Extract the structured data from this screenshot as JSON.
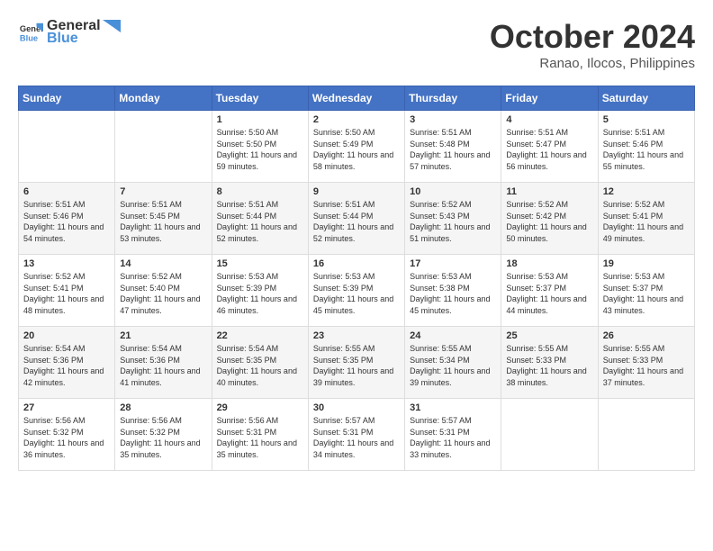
{
  "header": {
    "logo": {
      "general": "General",
      "blue": "Blue"
    },
    "title": "October 2024",
    "location": "Ranao, Ilocos, Philippines"
  },
  "weekdays": [
    "Sunday",
    "Monday",
    "Tuesday",
    "Wednesday",
    "Thursday",
    "Friday",
    "Saturday"
  ],
  "weeks": [
    [
      {
        "day": "",
        "sunrise": "",
        "sunset": "",
        "daylight": ""
      },
      {
        "day": "",
        "sunrise": "",
        "sunset": "",
        "daylight": ""
      },
      {
        "day": "1",
        "sunrise": "Sunrise: 5:50 AM",
        "sunset": "Sunset: 5:50 PM",
        "daylight": "Daylight: 11 hours and 59 minutes."
      },
      {
        "day": "2",
        "sunrise": "Sunrise: 5:50 AM",
        "sunset": "Sunset: 5:49 PM",
        "daylight": "Daylight: 11 hours and 58 minutes."
      },
      {
        "day": "3",
        "sunrise": "Sunrise: 5:51 AM",
        "sunset": "Sunset: 5:48 PM",
        "daylight": "Daylight: 11 hours and 57 minutes."
      },
      {
        "day": "4",
        "sunrise": "Sunrise: 5:51 AM",
        "sunset": "Sunset: 5:47 PM",
        "daylight": "Daylight: 11 hours and 56 minutes."
      },
      {
        "day": "5",
        "sunrise": "Sunrise: 5:51 AM",
        "sunset": "Sunset: 5:46 PM",
        "daylight": "Daylight: 11 hours and 55 minutes."
      }
    ],
    [
      {
        "day": "6",
        "sunrise": "Sunrise: 5:51 AM",
        "sunset": "Sunset: 5:46 PM",
        "daylight": "Daylight: 11 hours and 54 minutes."
      },
      {
        "day": "7",
        "sunrise": "Sunrise: 5:51 AM",
        "sunset": "Sunset: 5:45 PM",
        "daylight": "Daylight: 11 hours and 53 minutes."
      },
      {
        "day": "8",
        "sunrise": "Sunrise: 5:51 AM",
        "sunset": "Sunset: 5:44 PM",
        "daylight": "Daylight: 11 hours and 52 minutes."
      },
      {
        "day": "9",
        "sunrise": "Sunrise: 5:51 AM",
        "sunset": "Sunset: 5:44 PM",
        "daylight": "Daylight: 11 hours and 52 minutes."
      },
      {
        "day": "10",
        "sunrise": "Sunrise: 5:52 AM",
        "sunset": "Sunset: 5:43 PM",
        "daylight": "Daylight: 11 hours and 51 minutes."
      },
      {
        "day": "11",
        "sunrise": "Sunrise: 5:52 AM",
        "sunset": "Sunset: 5:42 PM",
        "daylight": "Daylight: 11 hours and 50 minutes."
      },
      {
        "day": "12",
        "sunrise": "Sunrise: 5:52 AM",
        "sunset": "Sunset: 5:41 PM",
        "daylight": "Daylight: 11 hours and 49 minutes."
      }
    ],
    [
      {
        "day": "13",
        "sunrise": "Sunrise: 5:52 AM",
        "sunset": "Sunset: 5:41 PM",
        "daylight": "Daylight: 11 hours and 48 minutes."
      },
      {
        "day": "14",
        "sunrise": "Sunrise: 5:52 AM",
        "sunset": "Sunset: 5:40 PM",
        "daylight": "Daylight: 11 hours and 47 minutes."
      },
      {
        "day": "15",
        "sunrise": "Sunrise: 5:53 AM",
        "sunset": "Sunset: 5:39 PM",
        "daylight": "Daylight: 11 hours and 46 minutes."
      },
      {
        "day": "16",
        "sunrise": "Sunrise: 5:53 AM",
        "sunset": "Sunset: 5:39 PM",
        "daylight": "Daylight: 11 hours and 45 minutes."
      },
      {
        "day": "17",
        "sunrise": "Sunrise: 5:53 AM",
        "sunset": "Sunset: 5:38 PM",
        "daylight": "Daylight: 11 hours and 45 minutes."
      },
      {
        "day": "18",
        "sunrise": "Sunrise: 5:53 AM",
        "sunset": "Sunset: 5:37 PM",
        "daylight": "Daylight: 11 hours and 44 minutes."
      },
      {
        "day": "19",
        "sunrise": "Sunrise: 5:53 AM",
        "sunset": "Sunset: 5:37 PM",
        "daylight": "Daylight: 11 hours and 43 minutes."
      }
    ],
    [
      {
        "day": "20",
        "sunrise": "Sunrise: 5:54 AM",
        "sunset": "Sunset: 5:36 PM",
        "daylight": "Daylight: 11 hours and 42 minutes."
      },
      {
        "day": "21",
        "sunrise": "Sunrise: 5:54 AM",
        "sunset": "Sunset: 5:36 PM",
        "daylight": "Daylight: 11 hours and 41 minutes."
      },
      {
        "day": "22",
        "sunrise": "Sunrise: 5:54 AM",
        "sunset": "Sunset: 5:35 PM",
        "daylight": "Daylight: 11 hours and 40 minutes."
      },
      {
        "day": "23",
        "sunrise": "Sunrise: 5:55 AM",
        "sunset": "Sunset: 5:35 PM",
        "daylight": "Daylight: 11 hours and 39 minutes."
      },
      {
        "day": "24",
        "sunrise": "Sunrise: 5:55 AM",
        "sunset": "Sunset: 5:34 PM",
        "daylight": "Daylight: 11 hours and 39 minutes."
      },
      {
        "day": "25",
        "sunrise": "Sunrise: 5:55 AM",
        "sunset": "Sunset: 5:33 PM",
        "daylight": "Daylight: 11 hours and 38 minutes."
      },
      {
        "day": "26",
        "sunrise": "Sunrise: 5:55 AM",
        "sunset": "Sunset: 5:33 PM",
        "daylight": "Daylight: 11 hours and 37 minutes."
      }
    ],
    [
      {
        "day": "27",
        "sunrise": "Sunrise: 5:56 AM",
        "sunset": "Sunset: 5:32 PM",
        "daylight": "Daylight: 11 hours and 36 minutes."
      },
      {
        "day": "28",
        "sunrise": "Sunrise: 5:56 AM",
        "sunset": "Sunset: 5:32 PM",
        "daylight": "Daylight: 11 hours and 35 minutes."
      },
      {
        "day": "29",
        "sunrise": "Sunrise: 5:56 AM",
        "sunset": "Sunset: 5:31 PM",
        "daylight": "Daylight: 11 hours and 35 minutes."
      },
      {
        "day": "30",
        "sunrise": "Sunrise: 5:57 AM",
        "sunset": "Sunset: 5:31 PM",
        "daylight": "Daylight: 11 hours and 34 minutes."
      },
      {
        "day": "31",
        "sunrise": "Sunrise: 5:57 AM",
        "sunset": "Sunset: 5:31 PM",
        "daylight": "Daylight: 11 hours and 33 minutes."
      },
      {
        "day": "",
        "sunrise": "",
        "sunset": "",
        "daylight": ""
      },
      {
        "day": "",
        "sunrise": "",
        "sunset": "",
        "daylight": ""
      }
    ]
  ]
}
